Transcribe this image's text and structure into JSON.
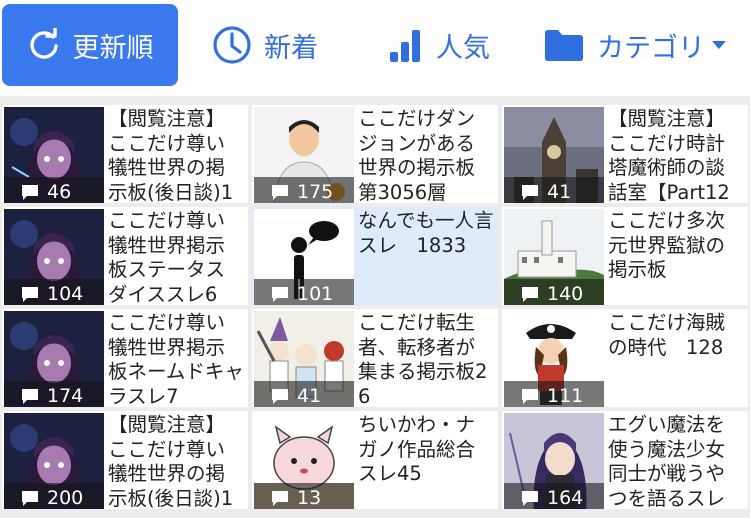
{
  "tabs": [
    {
      "label": "更新順",
      "icon": "refresh-icon",
      "active": true
    },
    {
      "label": "新着",
      "icon": "clock-icon",
      "active": false
    },
    {
      "label": "人気",
      "icon": "bar-chart-icon",
      "active": false
    },
    {
      "label": "カテゴリ",
      "icon": "folder-icon",
      "active": false,
      "dropdown": "caret-down-icon"
    }
  ],
  "colors": {
    "accent": "#3a78ee",
    "highlight": "#dfeafb",
    "background": "#ececec"
  },
  "threads": [
    {
      "title": "【閲覧注意】ここだけ尊い犠牲世界の掲示板(後日談)1",
      "count": "46",
      "thumb": "dark-haired-girl"
    },
    {
      "title": "ここだけダンジョンがある世界の掲示板　第3056層",
      "count": "175",
      "thumb": "astronaut"
    },
    {
      "title": "【閲覧注意】ここだけ時計塔魔術師の談話室【Part12",
      "count": "41",
      "thumb": "clock-tower"
    },
    {
      "title": "ここだけ尊い犠牲世界掲示板ステータスダイススレ6",
      "count": "104",
      "thumb": "dark-haired-girl"
    },
    {
      "title": "なんでも一人言スレ　1833",
      "count": "101",
      "thumb": "speech-figure"
    },
    {
      "title": "ここだけ多次元世界監獄の掲示板",
      "count": "140",
      "thumb": "prison-building"
    },
    {
      "title": "ここだけ尊い犠牲世界掲示板ネームドキャラスレ7",
      "count": "174",
      "thumb": "dark-haired-girl"
    },
    {
      "title": "ここだけ転生者、転移者が集まる掲示板26",
      "count": "41",
      "thumb": "party-characters"
    },
    {
      "title": "ここだけ海賊の時代　128",
      "count": "111",
      "thumb": "pirate-girl"
    },
    {
      "title": "【閲覧注意】ここだけ尊い犠牲世界の掲示板(後日談)1",
      "count": "200",
      "thumb": "dark-haired-girl"
    },
    {
      "title": "ちいかわ・ナガノ作品総合スレ45",
      "count": "13",
      "thumb": "pink-creature"
    },
    {
      "title": "エグい魔法を使う魔法少女同士が戦うやつを語るスレ",
      "count": "164",
      "thumb": "magical-girl"
    }
  ]
}
